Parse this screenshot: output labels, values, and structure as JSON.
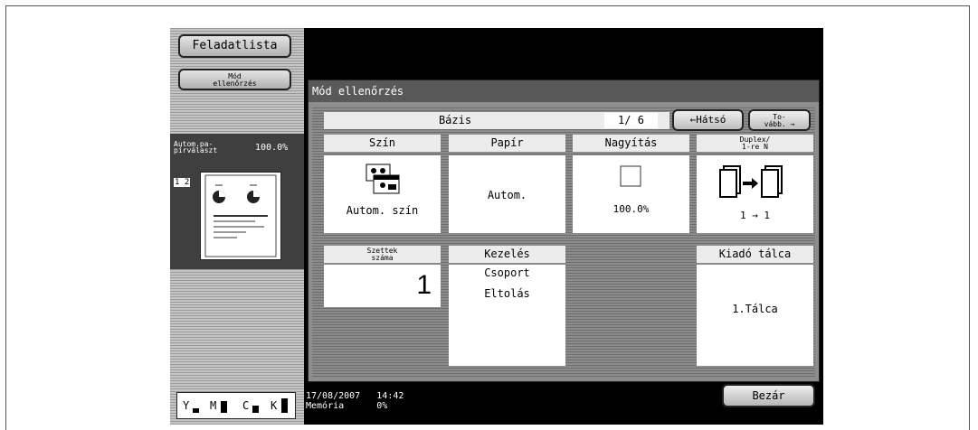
{
  "sidebar": {
    "task_list_label": "Feladatlista",
    "mode_check_label_line1": "Mód",
    "mode_check_label_line2": "ellenőrzés",
    "preview": {
      "label_line1": "Autom.pa-",
      "label_line2": "pírválaszt",
      "zoom": "100.0%",
      "page_indicator": "1 2"
    },
    "toner_levels": [
      {
        "color": "Y",
        "level": 0.3
      },
      {
        "color": "M",
        "level": 0.8
      },
      {
        "color": "C",
        "level": 0.5
      },
      {
        "color": "K",
        "level": 1.0
      }
    ]
  },
  "panel": {
    "title": "Mód ellenőrzés",
    "base": {
      "label": "Bázis",
      "page": "1/ 6"
    },
    "nav": {
      "back_label": "←Hátsó",
      "next_label_line1": "To-",
      "next_label_line2": "vább. →"
    },
    "cells": {
      "color": {
        "header": "Szín",
        "value": "Autom. szín"
      },
      "paper": {
        "header": "Papír",
        "value": "Autom."
      },
      "zoom": {
        "header": "Nagyítás",
        "value": "100.0%"
      },
      "duplex": {
        "header_line1": "Duplex/",
        "header_line2": "1-re N",
        "value": "1 → 1"
      },
      "sets": {
        "header_line1": "Szettek",
        "header_line2": "száma",
        "value": "1"
      },
      "finishing": {
        "header": "Kezelés",
        "value_line1": "Csoport",
        "value_line2": "Eltolás"
      },
      "output": {
        "header": "Kiadó tálca",
        "value": "1.Tálca"
      }
    }
  },
  "status": {
    "date": "17/08/2007",
    "time": "14:42",
    "memory_label": "Memória",
    "memory_value": "0%",
    "close_label": "Bezár"
  }
}
